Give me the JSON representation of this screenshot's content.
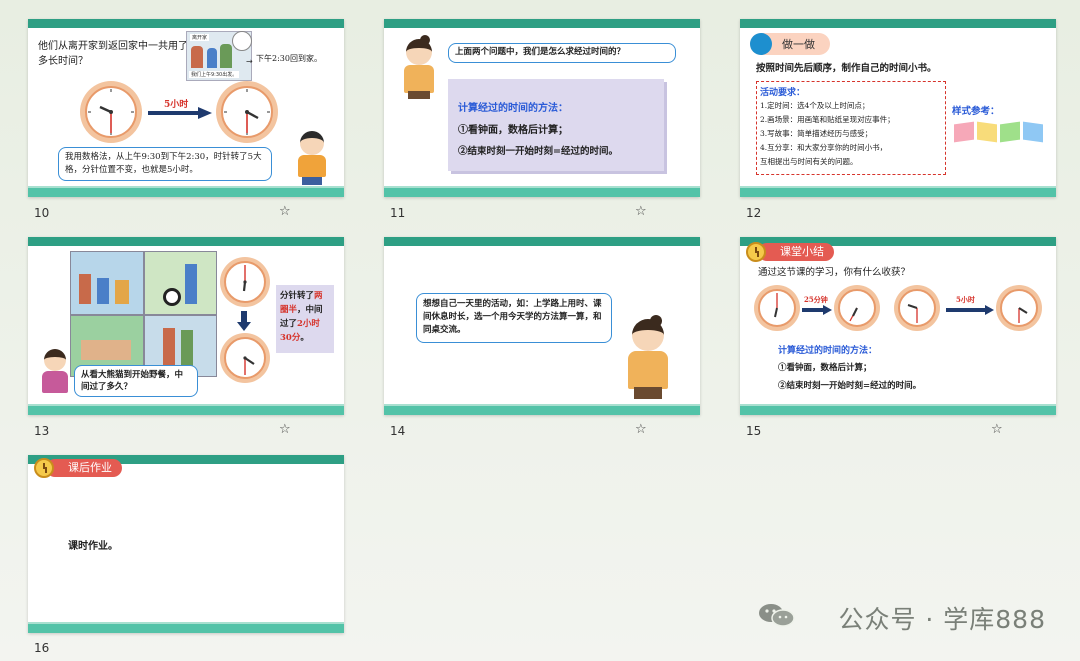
{
  "slides": [
    {
      "number": "10",
      "question": "他们从离开家到返回家中一共用了多长时间？",
      "picture_caption_top": "离开家",
      "picture_caption_bottom": "我们上午9:30出发。",
      "right_note": "下午2:30回到家。",
      "arrow_label": "5小时",
      "explanation": "我用数格法，从上午9:30到下午2:30，时针转了5大格，分针位置不变，也就是5小时。"
    },
    {
      "number": "11",
      "speech": "上面两个问题中，我们是怎么求经过时间的？",
      "method_title": "计算经过的时间的方法：",
      "method_1": "①看钟面，数格后计算；",
      "method_2": "②结束时刻一开始时刻=经过的时间。"
    },
    {
      "number": "12",
      "badge": "做一做",
      "instruction": "按照时间先后顺序，制作自己的时间小书。",
      "req_title": "活动要求：",
      "req_1": "1.定时间：选4个及以上时间点；",
      "req_2": "2.画场景：用画笔和贴纸呈现对应事件；",
      "req_3": "3.写故事：简单描述经历与感受；",
      "req_4": "4.互分享：和大家分享你的时间小书，",
      "req_5": "互相提出与时间有关的问题。",
      "sample_label": "样式参考："
    },
    {
      "number": "13",
      "side_text_1": "分针转了",
      "side_text_highlight_1": "两圈半",
      "side_text_2": "，中间过了",
      "side_text_highlight_2": "2小时30分",
      "side_text_3": "。",
      "question": "从看大熊猫到开始野餐，中间过了多久？"
    },
    {
      "number": "14",
      "speech": "想想自己一天里的活动，如：上学路上用时、课间休息时长，选一个用今天学的方法算一算，和同桌交流。"
    },
    {
      "number": "15",
      "badge": "课堂小结",
      "question": "通过这节课的学习，你有什么收获？",
      "arrow_label_1": "25分钟",
      "arrow_label_2": "5小时",
      "method_title": "计算经过的时间的方法：",
      "method_1": "①看钟面，数格后计算；",
      "method_2": "②结束时刻一开始时刻=经过的时间。"
    },
    {
      "number": "16",
      "badge": "课后作业",
      "content": "课时作业。"
    }
  ],
  "star_icon": "☆",
  "watermark": "公众号 · 学库888",
  "colors": {
    "header_bar": "#2e9f84",
    "footer_bar": "#53c3a8",
    "badge_red": "#e45b52",
    "method_blue": "#2a5bd7",
    "highlight_red": "#d6332b"
  }
}
